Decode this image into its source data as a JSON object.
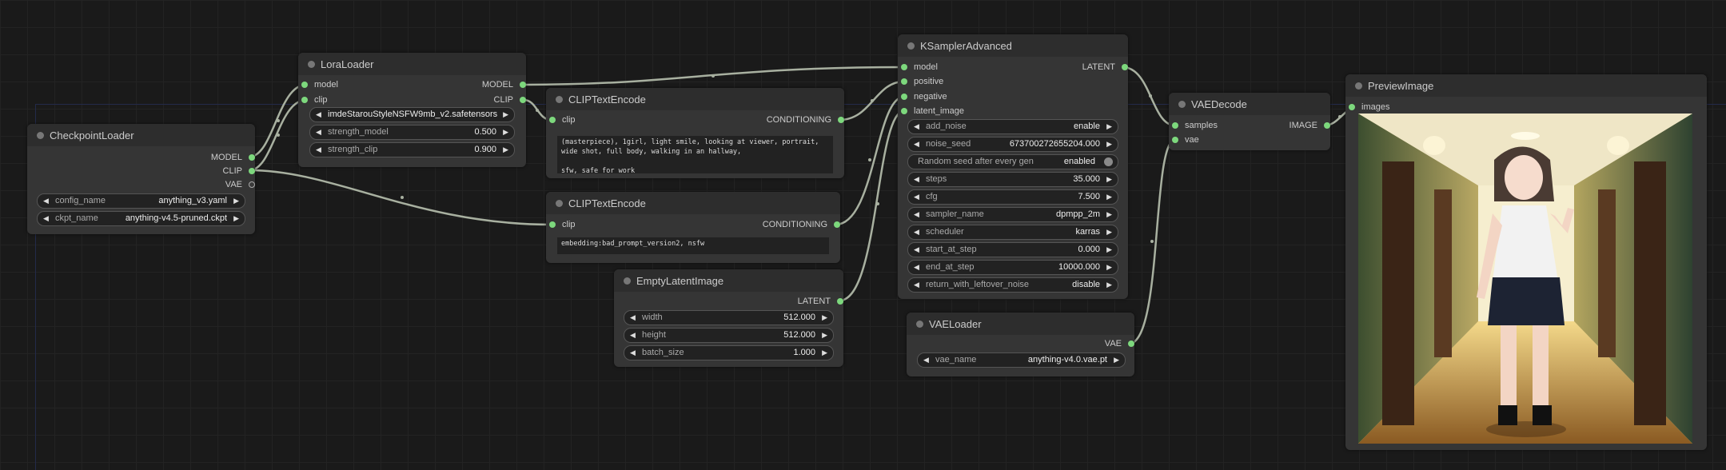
{
  "nodes": {
    "checkpoint": {
      "title": "CheckpointLoader",
      "outputs": [
        "MODEL",
        "CLIP",
        "VAE"
      ],
      "widgets": [
        {
          "label": "config_name",
          "value": "anything_v3.yaml"
        },
        {
          "label": "ckpt_name",
          "value": "anything-v4.5-pruned.ckpt"
        }
      ]
    },
    "lora": {
      "title": "LoraLoader",
      "inputs": [
        "model",
        "clip"
      ],
      "outputs": [
        "MODEL",
        "CLIP"
      ],
      "lora_name": "imdeStarouStyleNSFW9mb_v2.safetensors",
      "widgets": [
        {
          "label": "strength_model",
          "value": "0.500"
        },
        {
          "label": "strength_clip",
          "value": "0.900"
        }
      ]
    },
    "clip1": {
      "title": "CLIPTextEncode",
      "input": "clip",
      "output": "CONDITIONING",
      "text": "(masterpiece), 1girl, light smile, looking at viewer, portrait, wide shot, full body, walking in an hallway,\n\nsfw, safe for work"
    },
    "clip2": {
      "title": "CLIPTextEncode",
      "input": "clip",
      "output": "CONDITIONING",
      "text": "embedding:bad_prompt_version2, nsfw"
    },
    "empty": {
      "title": "EmptyLatentImage",
      "output": "LATENT",
      "widgets": [
        {
          "label": "width",
          "value": "512.000"
        },
        {
          "label": "height",
          "value": "512.000"
        },
        {
          "label": "batch_size",
          "value": "1.000"
        }
      ]
    },
    "ksampler": {
      "title": "KSamplerAdvanced",
      "inputs": [
        "model",
        "positive",
        "negative",
        "latent_image"
      ],
      "output": "LATENT",
      "widgets": [
        {
          "label": "add_noise",
          "value": "enable"
        },
        {
          "label": "noise_seed",
          "value": "673700272655204.000"
        },
        {
          "label": "Random seed after every gen",
          "value": "enabled"
        },
        {
          "label": "steps",
          "value": "35.000"
        },
        {
          "label": "cfg",
          "value": "7.500"
        },
        {
          "label": "sampler_name",
          "value": "dpmpp_2m"
        },
        {
          "label": "scheduler",
          "value": "karras"
        },
        {
          "label": "start_at_step",
          "value": "0.000"
        },
        {
          "label": "end_at_step",
          "value": "10000.000"
        },
        {
          "label": "return_with_leftover_noise",
          "value": "disable"
        }
      ]
    },
    "vaeloader": {
      "title": "VAELoader",
      "output": "VAE",
      "widgets": [
        {
          "label": "vae_name",
          "value": "anything-v4.0.vae.pt"
        }
      ]
    },
    "vaedecode": {
      "title": "VAEDecode",
      "inputs": [
        "samples",
        "vae"
      ],
      "output": "IMAGE"
    },
    "preview": {
      "title": "PreviewImage",
      "input": "images"
    }
  },
  "colors": {
    "canvas": "#1a1a1a",
    "node": "#353535",
    "header": "#2d2d2d",
    "slot": "#7dd87d",
    "wire": "#a8b0a0"
  }
}
